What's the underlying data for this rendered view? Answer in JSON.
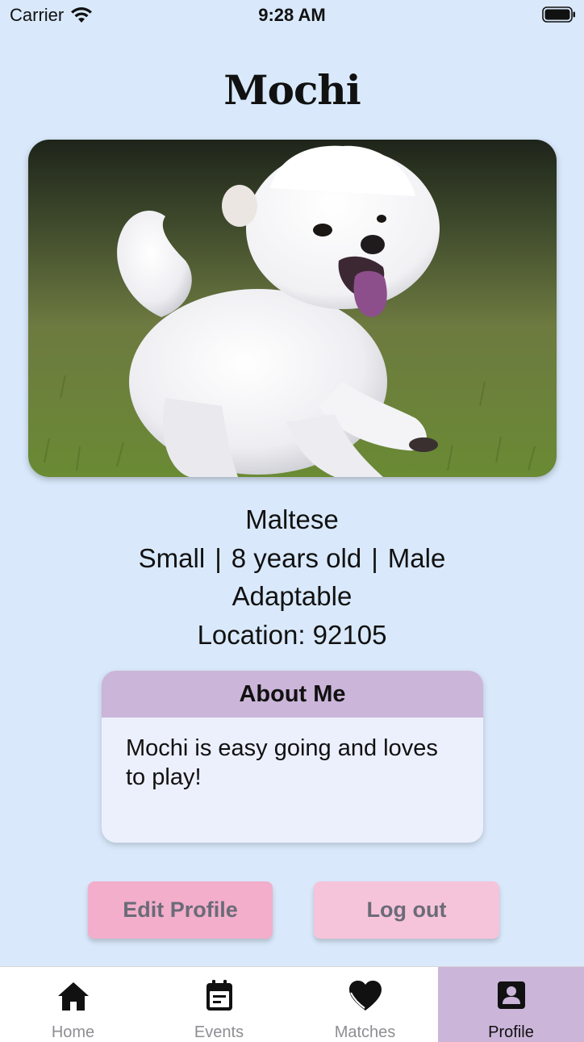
{
  "status_bar": {
    "carrier": "Carrier",
    "time": "9:28 AM"
  },
  "profile": {
    "name": "Mochi",
    "breed": "Maltese",
    "size": "Small",
    "age": "8 years old",
    "sex": "Male",
    "temperament": "Adaptable",
    "location": "Location: 92105",
    "separator": "|"
  },
  "about": {
    "heading": "About Me",
    "text": "Mochi is easy going and loves to play!"
  },
  "buttons": {
    "edit_profile": "Edit Profile",
    "log_out": "Log out"
  },
  "tabs": [
    {
      "label": "Home",
      "icon": "home-icon",
      "active": false
    },
    {
      "label": "Events",
      "icon": "calendar-icon",
      "active": false
    },
    {
      "label": "Matches",
      "icon": "heart-icon",
      "active": false
    },
    {
      "label": "Profile",
      "icon": "profile-icon",
      "active": true
    }
  ],
  "colors": {
    "background": "#d9e9fb",
    "about_header": "#cbb5d9",
    "about_body": "#ecf0fd",
    "edit_button": "#f2aeca",
    "logout_button": "#f6c4da",
    "active_tab": "#cbb5d9"
  }
}
